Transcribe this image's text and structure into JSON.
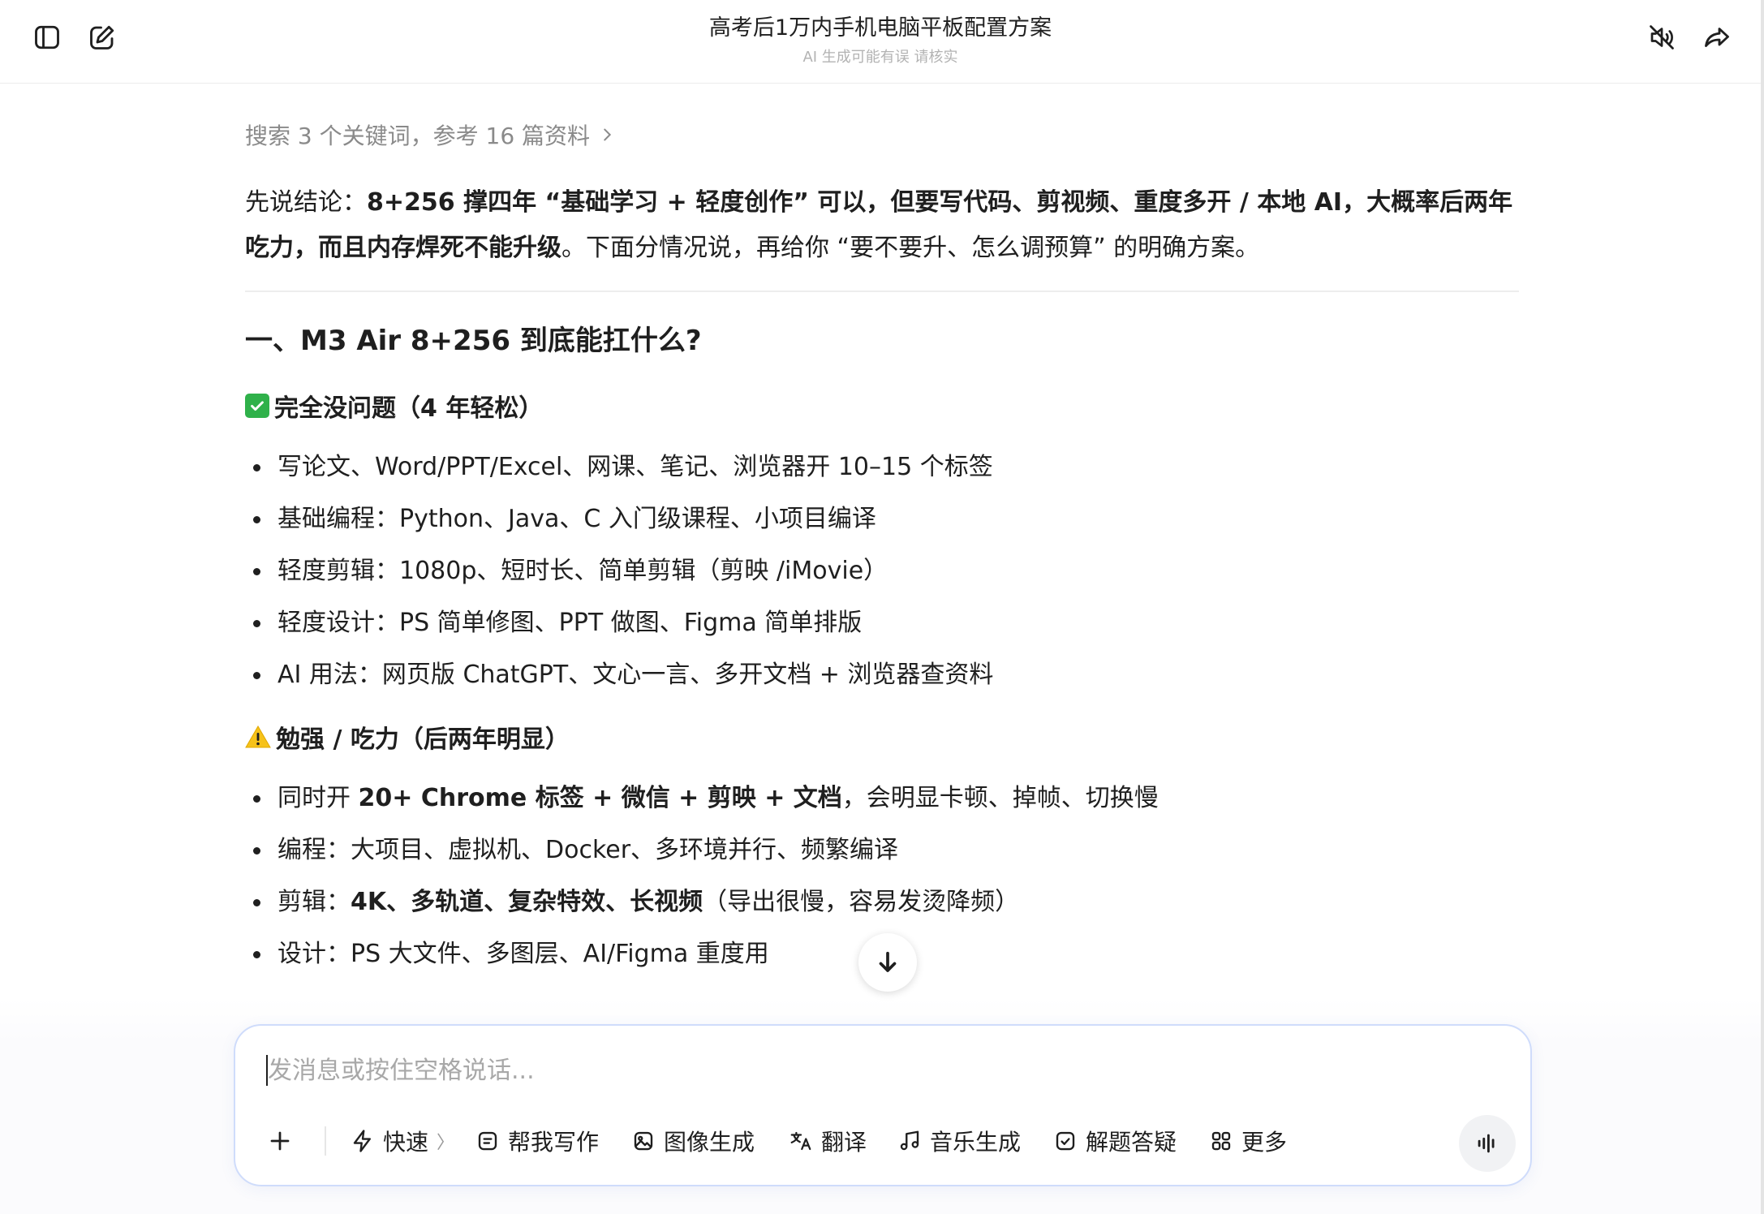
{
  "header": {
    "title": "高考后1万内手机电脑平板配置方案",
    "subtitle": "AI 生成可能有误 请核实",
    "left_icons": [
      "sidebar-toggle-icon",
      "new-chat-icon"
    ],
    "right_icons": [
      "speaker-muted-icon",
      "share-icon"
    ]
  },
  "message": {
    "search_summary": "搜索 3 个关键词，参考 16 篇资料",
    "lead": {
      "prefix": "先说结论：",
      "bold": "8+256 撑四年 “基础学习 + 轻度创作” 可以，但要写代码、剪视频、重度多开 / 本地 AI，大概率后两年吃力，而且内存焊死不能升级",
      "suffix": "。下面分情况说，再给你 “要不要升、怎么调预算” 的明确方案。"
    },
    "section_title": "一、M3 Air 8+256 到底能扛什么?",
    "ok_group": {
      "emoji": "check-mark-icon",
      "title": "完全没问题（4 年轻松）",
      "items": [
        "写论文、Word/PPT/Excel、网课、笔记、浏览器开 10–15 个标签",
        "基础编程：Python、Java、C 入门级课程、小项目编译",
        "轻度剪辑：1080p、短时长、简单剪辑（剪映 /iMovie）",
        "轻度设计：PS 简单修图、PPT 做图、Figma 简单排版",
        "AI 用法：网页版 ChatGPT、文心一言、多开文档 + 浏览器查资料"
      ]
    },
    "warn_group": {
      "emoji": "warning-icon",
      "title": "勉强 / 吃力（后两年明显）",
      "items": [
        {
          "prefix": "同时开 ",
          "bold": "20+ Chrome 标签 + 微信 + 剪映 + 文档",
          "suffix": "，会明显卡顿、掉帧、切换慢"
        },
        {
          "prefix": "编程：大项目、虚拟机、Docker、多环境并行、频繁编译",
          "bold": "",
          "suffix": ""
        },
        {
          "prefix": "剪辑：",
          "bold": "4K、多轨道、复杂特效、长视频",
          "suffix": "（导出很慢，容易发烫降频）"
        },
        {
          "prefix": "设计：PS 大文件、多图层、AI/Figma 重度用",
          "bold": "",
          "suffix": ""
        }
      ]
    }
  },
  "composer": {
    "placeholder": "发消息或按住空格说话...",
    "tools": [
      {
        "label": "快速",
        "icon": "lightning-icon"
      },
      {
        "label": "帮我写作",
        "icon": "document-icon"
      },
      {
        "label": "图像生成",
        "icon": "image-icon"
      },
      {
        "label": "翻译",
        "icon": "translate-icon"
      },
      {
        "label": "音乐生成",
        "icon": "music-note-icon"
      },
      {
        "label": "解题答疑",
        "icon": "check-box-icon"
      },
      {
        "label": "更多",
        "icon": "grid-icon"
      }
    ],
    "speed_chevron": "〉"
  }
}
